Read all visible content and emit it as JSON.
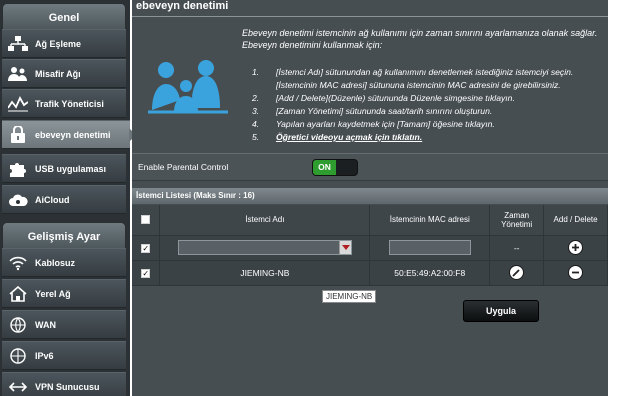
{
  "sidebar": {
    "general_header": "Genel",
    "items": [
      {
        "label": "Ağ Eşleme",
        "icon": "network-map-icon"
      },
      {
        "label": "Misafir Ağı",
        "icon": "guest-network-icon"
      },
      {
        "label": "Trafik Yöneticisi",
        "icon": "traffic-manager-icon"
      },
      {
        "label": "ebeveyn denetimi",
        "icon": "lock-icon"
      },
      {
        "label": "USB uygulaması",
        "icon": "puzzle-icon"
      },
      {
        "label": "AiCloud",
        "icon": "cloud-icon"
      }
    ],
    "advanced_header": "Gelişmiş Ayar",
    "advanced_items": [
      {
        "label": "Kablosuz",
        "icon": "wireless-icon"
      },
      {
        "label": "Yerel Ağ",
        "icon": "home-icon"
      },
      {
        "label": "WAN",
        "icon": "globe-icon"
      },
      {
        "label": "IPv6",
        "icon": "ipv6-globe-icon"
      },
      {
        "label": "VPN Sunucusu",
        "icon": "vpn-icon"
      }
    ]
  },
  "main": {
    "title": "ebeveyn denetimi",
    "description": "Ebeveyn denetimi istemcinin ağ kullanımı için zaman sınırını ayarlamanıza olanak sağlar. Ebeveyn denetimini kullanmak için:",
    "steps": [
      {
        "num": "1.",
        "text": "[İstemci Adı] sütunundan ağ kullanımını denetlemek istediğiniz istemciyi seçin. [İstemcinin MAC adresi] sütununa istemcinin MAC adresini de girebilirsiniz."
      },
      {
        "num": "2.",
        "text": "[Add / Delete](Düzenle) sütununda Düzenle simgesine tıklayın."
      },
      {
        "num": "3.",
        "text": "[Zaman Yönetimi] sütununda saat/tarih sınırını oluşturun."
      },
      {
        "num": "4.",
        "text": "Yapılan ayarları kaydetmek için [Tamam] öğesine tıklayın."
      },
      {
        "num": "5.",
        "text": "Öğretici videoyu açmak için tıklatın."
      }
    ],
    "enable_label": "Enable Parental Control",
    "toggle_on": "ON",
    "list_header": "İstemci Listesi (Maks Sınır : 16)",
    "columns": {
      "name": "İstemci Adı",
      "mac": "İstemcinin MAC adresi",
      "time": "Zaman Yönetimi",
      "add_delete": "Add / Delete"
    },
    "new_row_time": "--",
    "clients": [
      {
        "name": "JIEMING-NB",
        "mac": "50:E5:49:A2:00:F8"
      }
    ],
    "tooltip": "JIEMING-NB",
    "apply_label": "Uygula"
  }
}
